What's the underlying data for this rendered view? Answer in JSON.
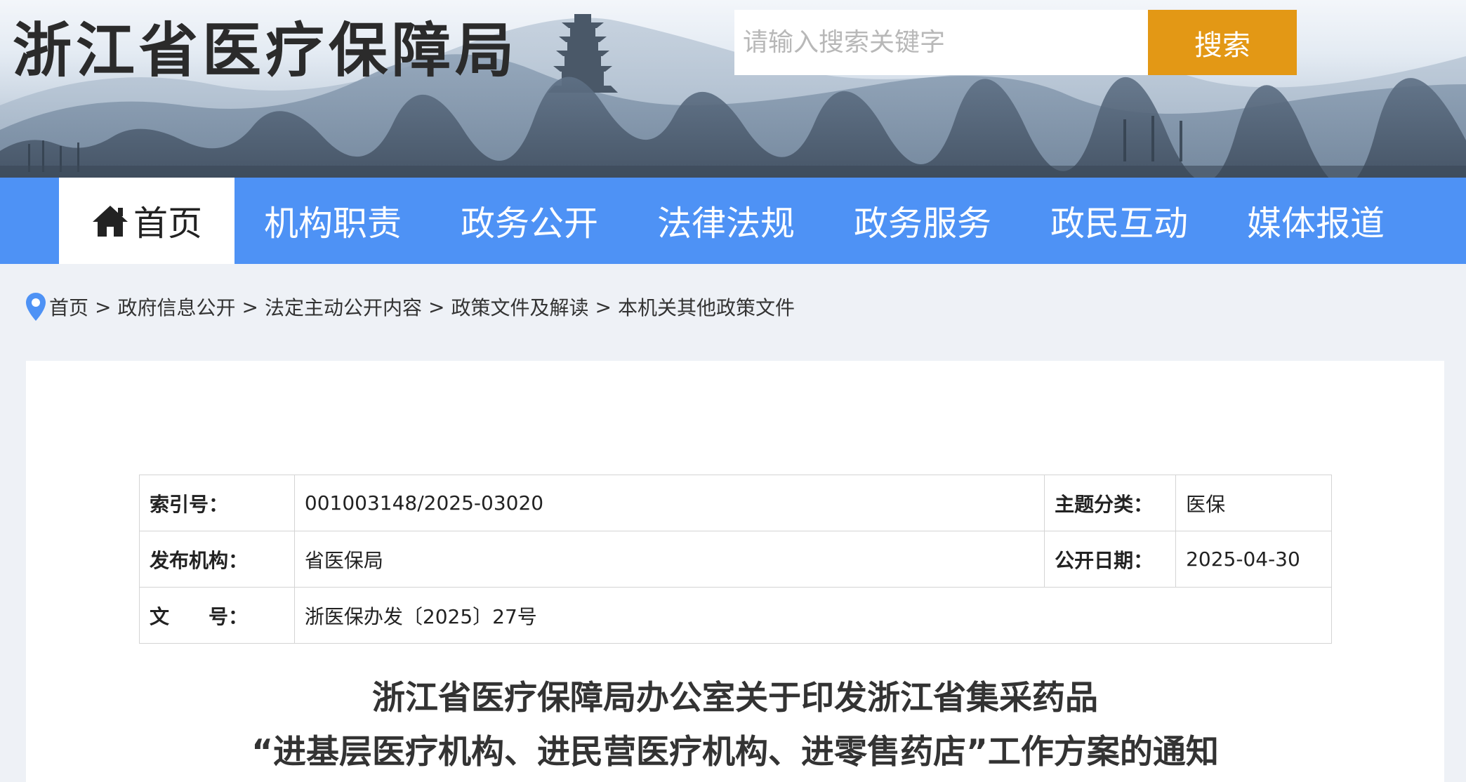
{
  "header": {
    "site_title": "浙江省医疗保障局",
    "search_placeholder": "请输入搜索关键字",
    "search_button": "搜索"
  },
  "nav": {
    "items": [
      {
        "label": "首页",
        "active": true
      },
      {
        "label": "机构职责"
      },
      {
        "label": "政务公开"
      },
      {
        "label": "法律法规"
      },
      {
        "label": "政务服务"
      },
      {
        "label": "政民互动"
      },
      {
        "label": "媒体报道"
      }
    ]
  },
  "breadcrumb": {
    "items": [
      "首页",
      "政府信息公开",
      "法定主动公开内容",
      "政策文件及解读",
      "本机关其他政策文件"
    ],
    "separator": ">"
  },
  "meta": {
    "index_label": "索引号：",
    "index_value": "001003148/2025-03020",
    "topic_label": "主题分类：",
    "topic_value": "医保",
    "publisher_label": "发布机构：",
    "publisher_value": "省医保局",
    "date_label": "公开日期：",
    "date_value": "2025-04-30",
    "docno_label": "文　　号：",
    "docno_value": "浙医保办发〔2025〕27号"
  },
  "document": {
    "title_line1": "浙江省医疗保障局办公室关于印发浙江省集采药品",
    "title_line2": "“进基层医疗机构、进民营医疗机构、进零售药店”工作方案的通知"
  },
  "colors": {
    "nav_bg": "#4e92f5",
    "search_button_bg": "#e39815",
    "page_bg": "#eef1f6",
    "pin_icon": "#4e92f5"
  },
  "icons": {
    "home": "home-icon",
    "location": "location-pin-icon"
  }
}
